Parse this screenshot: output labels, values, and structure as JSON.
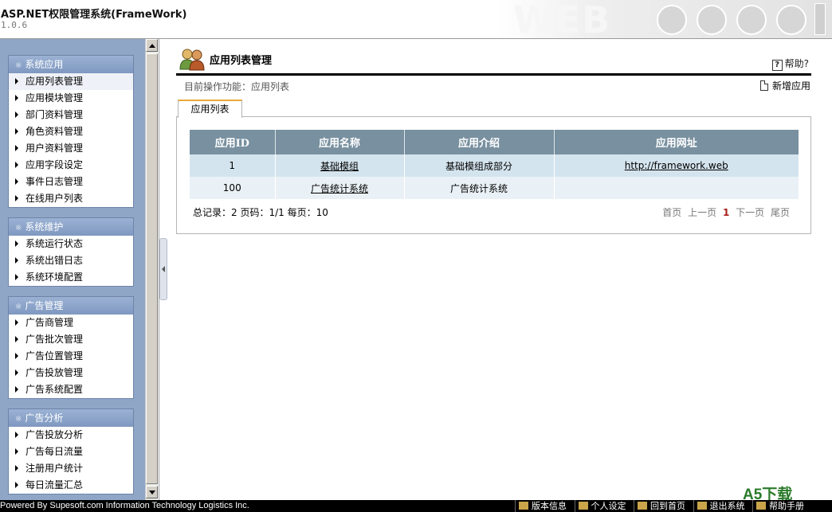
{
  "header": {
    "title": "ASP.NET权限管理系统(FrameWork)",
    "version": "1.0.6"
  },
  "sidebar": {
    "groups": [
      {
        "title": "系统应用",
        "items": [
          "应用列表管理",
          "应用模块管理",
          "部门资料管理",
          "角色资料管理",
          "用户资料管理",
          "应用字段设定",
          "事件日志管理",
          "在线用户列表"
        ]
      },
      {
        "title": "系统维护",
        "items": [
          "系统运行状态",
          "系统出错日志",
          "系统环境配置"
        ]
      },
      {
        "title": "广告管理",
        "items": [
          "广告商管理",
          "广告批次管理",
          "广告位置管理",
          "广告投放管理",
          "广告系统配置"
        ]
      },
      {
        "title": "广告分析",
        "items": [
          "广告投放分析",
          "广告每日流量",
          "注册用户统计",
          "每日流量汇总"
        ]
      }
    ]
  },
  "main": {
    "title": "应用列表管理",
    "help": "帮助?",
    "breadcrumb": "目前操作功能：应用列表",
    "add_button": "新增应用",
    "tab": "应用列表",
    "table": {
      "columns": [
        "应用ID",
        "应用名称",
        "应用介绍",
        "应用网址"
      ],
      "rows": [
        {
          "id": "1",
          "name": "基础模组",
          "desc": "基础模组成部分",
          "url": "http://framework.web"
        },
        {
          "id": "100",
          "name": "广告统计系统",
          "desc": "广告统计系统",
          "url": ""
        }
      ]
    },
    "summary": "总记录：2 页码：1/1 每页：10",
    "pager": {
      "first": "首页",
      "prev": "上一页",
      "current": "1",
      "next": "下一页",
      "last": "尾页"
    }
  },
  "statusbar": {
    "powered": "Powered By Supesoft.com Information Technology Logistics Inc.",
    "items": [
      "版本信息",
      "个人设定",
      "回到首页",
      "退出系统",
      "帮助手册"
    ]
  },
  "watermark": "A5下载"
}
